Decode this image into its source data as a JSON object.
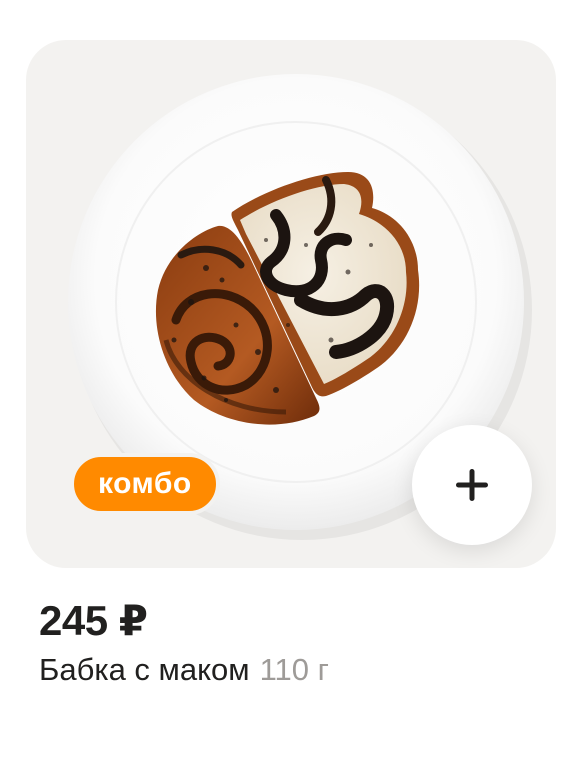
{
  "product": {
    "badge": "комбо",
    "price": "245 ₽",
    "name": "Бабка с маком",
    "weight": "110 г",
    "add_icon": "plus-icon",
    "image_alt_icon": "poppy-seed-babka-photo"
  },
  "colors": {
    "card_bg": "#f3f2f0",
    "badge_bg": "#ff8a00",
    "text_primary": "#21201f",
    "text_secondary": "#9e9b98"
  }
}
